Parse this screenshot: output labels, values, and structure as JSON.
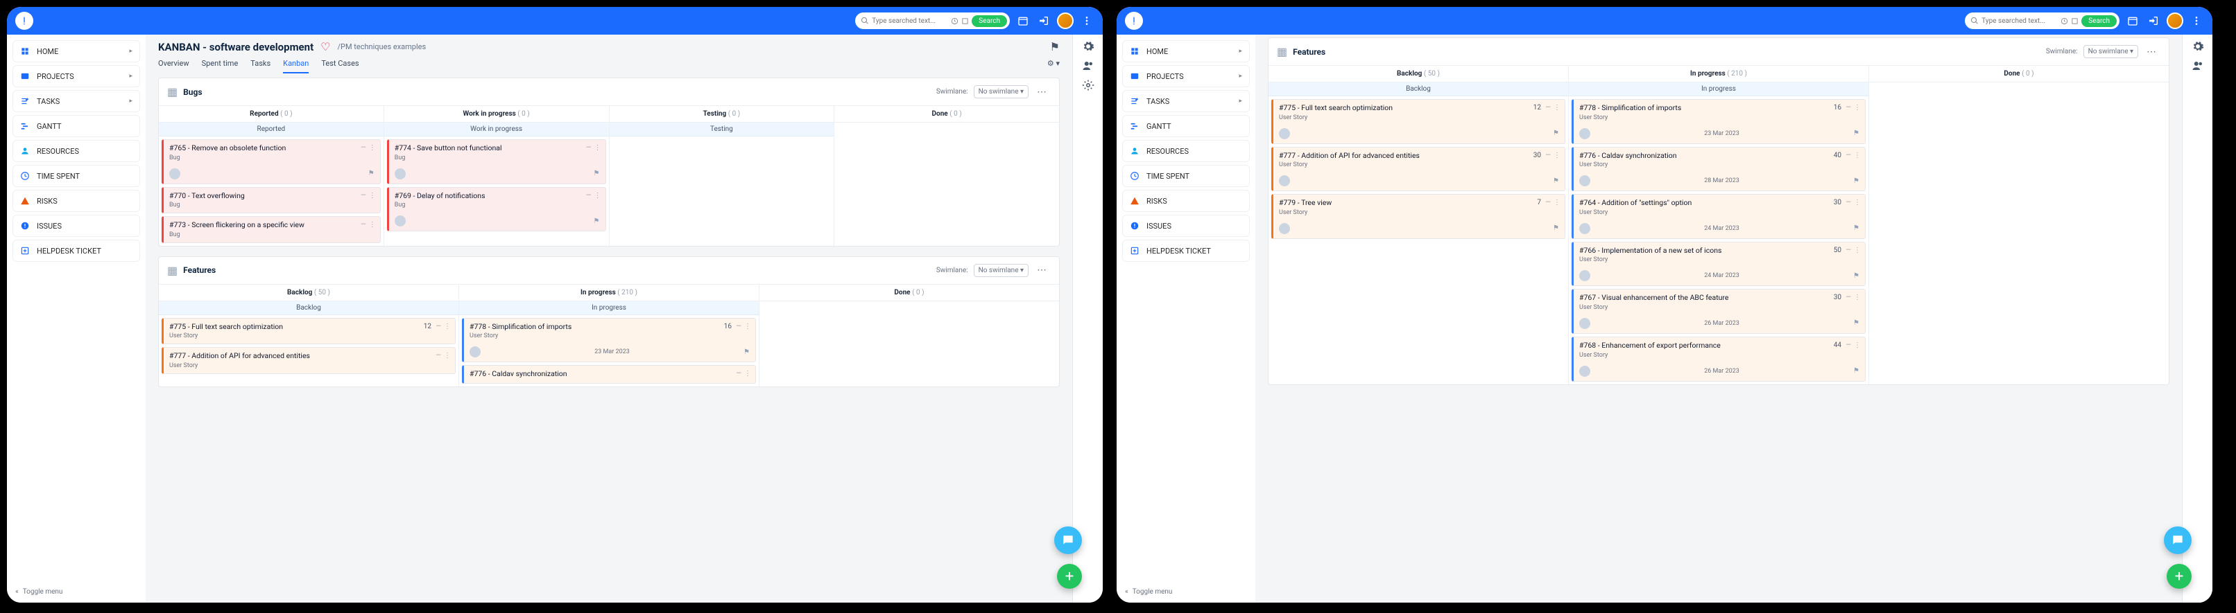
{
  "topbar": {
    "search_placeholder": "Type searched text...",
    "search_btn": "Search"
  },
  "sidebar": {
    "items": [
      {
        "icon": "home",
        "label": "HOME",
        "expand": true,
        "color": "#1c6bff"
      },
      {
        "icon": "projects",
        "label": "PROJECTS",
        "expand": true,
        "color": "#1c6bff"
      },
      {
        "icon": "tasks",
        "label": "TASKS",
        "expand": true,
        "color": "#1c6bff"
      },
      {
        "icon": "gantt",
        "label": "GANTT",
        "expand": false,
        "color": "#1c6bff"
      },
      {
        "icon": "resources",
        "label": "RESOURCES",
        "expand": false,
        "color": "#0ea5e9"
      },
      {
        "icon": "timespent",
        "label": "TIME SPENT",
        "expand": false,
        "color": "#1c6bff"
      },
      {
        "icon": "risks",
        "label": "RISKS",
        "expand": false,
        "color": "#ea580c"
      },
      {
        "icon": "issues",
        "label": "ISSUES",
        "expand": false,
        "color": "#1c6bff"
      },
      {
        "icon": "helpdesk",
        "label": "HELPDESK TICKET",
        "expand": false,
        "color": "#1c6bff"
      }
    ]
  },
  "project": {
    "title": "KANBAN - software development",
    "breadcrumb": "/PM techniques examples",
    "tabs": [
      "Overview",
      "Spent time",
      "Tasks",
      "Kanban",
      "Test Cases"
    ],
    "active_tab": 3
  },
  "swimlane_label": "Swimlane:",
  "swimlane_value": "No swimlane",
  "toggle_menu": "Toggle menu",
  "bugs_section": {
    "title": "Bugs",
    "columns": [
      {
        "name": "Reported",
        "count": "( 0 )",
        "wip": "Reported"
      },
      {
        "name": "Work in progress",
        "count": "( 0 )",
        "wip": "Work in progress"
      },
      {
        "name": "Testing",
        "count": "( 0 )",
        "wip": "Testing"
      },
      {
        "name": "Done",
        "count": "( 0 )"
      }
    ],
    "reported_cards": [
      {
        "title": "#765 - Remove an obsolete function",
        "sub": "Bug"
      },
      {
        "title": "#770 - Text overflowing",
        "sub": "Bug"
      },
      {
        "title": "#773 - Screen flickering on a specific view",
        "sub": "Bug"
      }
    ],
    "wip_cards": [
      {
        "title": "#774 - Save button not functional",
        "sub": "Bug"
      },
      {
        "title": "#769 - Delay of notifications",
        "sub": "Bug"
      }
    ]
  },
  "features_section": {
    "title": "Features",
    "columns": [
      {
        "name": "Backlog",
        "count": "( 50 )",
        "wip": "Backlog"
      },
      {
        "name": "In progress",
        "count": "( 210 )",
        "wip": "In progress"
      },
      {
        "name": "Done",
        "count": "( 0 )"
      }
    ],
    "backlog_cards_left": [
      {
        "title": "#775 - Full text search optimization",
        "sub": "User Story",
        "pts": "12"
      },
      {
        "title": "#777 - Addition of API for advanced entities",
        "sub": "User Story"
      }
    ],
    "backlog_cards_right": [
      {
        "title": "#775 - Full text search optimization",
        "sub": "User Story",
        "pts": "12"
      },
      {
        "title": "#777 - Addition of API for advanced entities",
        "sub": "User Story",
        "pts": "30"
      },
      {
        "title": "#779 - Tree view",
        "sub": "User Story",
        "pts": "7"
      }
    ],
    "inprog_cards_left": [
      {
        "title": "#778 - Simplification of imports",
        "sub": "User Story",
        "pts": "16",
        "date": "23 Mar 2023"
      },
      {
        "title": "#776 - Caldav synchronization",
        "sub": ""
      }
    ],
    "inprog_cards_right": [
      {
        "title": "#778 - Simplification of imports",
        "sub": "User Story",
        "pts": "16",
        "date": "23 Mar 2023"
      },
      {
        "title": "#776 - Caldav synchronization",
        "sub": "User Story",
        "pts": "40",
        "date": "28 Mar 2023"
      },
      {
        "title": "#764 - Addition of \"settings\" option",
        "sub": "User Story",
        "pts": "30",
        "date": "24 Mar 2023"
      },
      {
        "title": "#766 - Implementation of a new set of icons",
        "sub": "User Story",
        "pts": "50",
        "date": "24 Mar 2023"
      },
      {
        "title": "#767 - Visual enhancement of the ABC feature",
        "sub": "User Story",
        "pts": "30",
        "date": "26 Mar 2023"
      },
      {
        "title": "#768 - Enhancement of export performance",
        "sub": "User Story",
        "pts": "44",
        "date": "26 Mar 2023"
      }
    ]
  }
}
